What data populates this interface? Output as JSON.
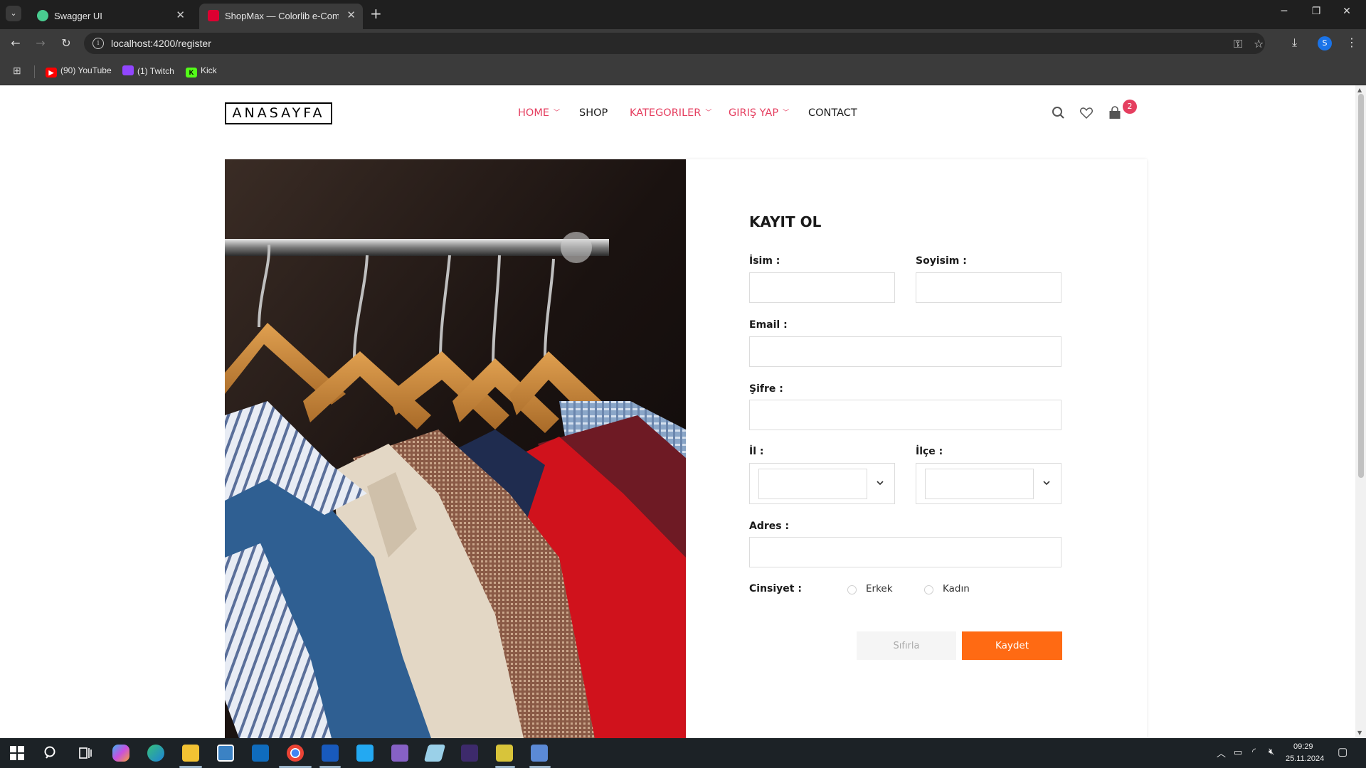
{
  "browser": {
    "tabs": [
      {
        "title": "Swagger UI",
        "active": false,
        "favicon_color": "#49cc90"
      },
      {
        "title": "ShopMax — Colorlib e-Comme",
        "active": true,
        "favicon_color": "#dd0031"
      }
    ],
    "url": "localhost:4200/register",
    "profile_initial": "S",
    "bookmarks": [
      {
        "label": "(90) YouTube",
        "icon_color": "#ff0000"
      },
      {
        "label": "(1) Twitch",
        "icon_color": "#9146ff"
      },
      {
        "label": "Kick",
        "icon_color": "#53fc18"
      }
    ]
  },
  "site": {
    "logo": "ANASAYFA",
    "nav": {
      "home": "HOME",
      "shop": "SHOP",
      "categories": "KATEGORILER",
      "login": "GIRIŞ YAP",
      "contact": "CONTACT"
    },
    "cart_count": "2",
    "accent_color": "#e53e5f"
  },
  "form": {
    "title": "KAYIT OL",
    "labels": {
      "first_name": "İsim :",
      "last_name": "Soyisim :",
      "email": "Email :",
      "password": "Şifre :",
      "city": "İl :",
      "district": "İlçe :",
      "address": "Adres :",
      "gender": "Cinsiyet :"
    },
    "values": {
      "first_name": "",
      "last_name": "",
      "email": "",
      "password": "",
      "city": "",
      "district": "",
      "address": ""
    },
    "gender_options": [
      "Erkek",
      "Kadın"
    ],
    "reset_label": "Sıfırla",
    "submit_label": "Kaydet",
    "submit_color": "#ff6a13"
  },
  "taskbar": {
    "time": "09:29",
    "date": "25.11.2024"
  }
}
